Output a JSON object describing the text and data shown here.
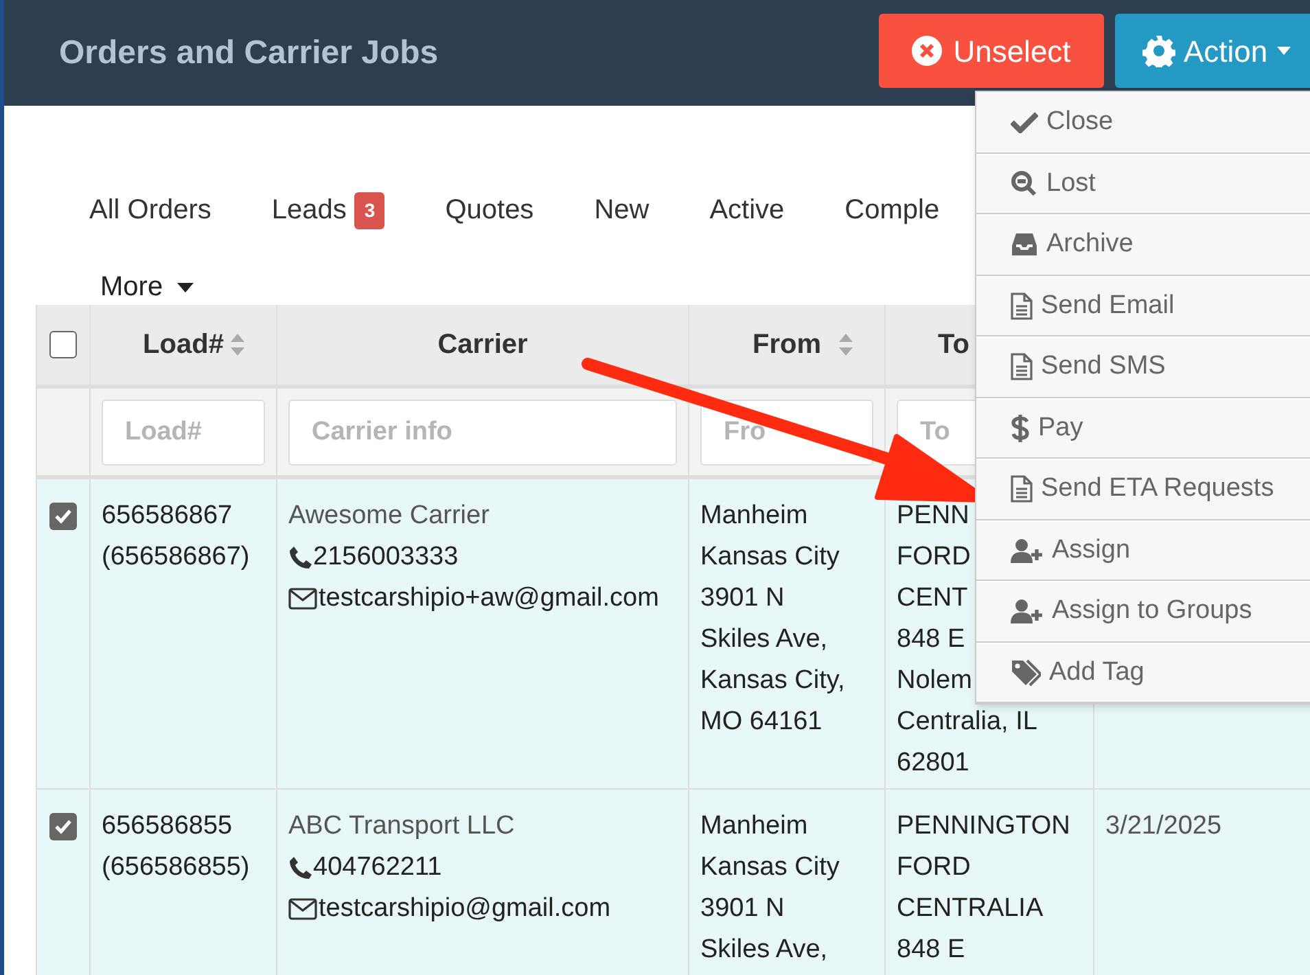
{
  "header": {
    "title": "Orders and Carrier Jobs",
    "unselect_button": "Unselect",
    "action_button": "Action"
  },
  "tabs": [
    {
      "label": "All Orders",
      "selected": false
    },
    {
      "label": "Leads",
      "selected": false,
      "badge": "3"
    },
    {
      "label": "Quotes",
      "selected": false
    },
    {
      "label": "New",
      "selected": false
    },
    {
      "label": "Active",
      "selected": false
    },
    {
      "label": "Comple",
      "selected": false
    }
  ],
  "more_tab": "More",
  "table": {
    "all_checked": false,
    "columns": [
      {
        "label": "Load#",
        "sortable": true
      },
      {
        "label": "Carrier",
        "sortable": false
      },
      {
        "label": "From",
        "sortable": true
      },
      {
        "label": "To",
        "sortable": false
      }
    ],
    "placeholders": [
      "Load#",
      "Carrier info",
      "Fro",
      "To"
    ],
    "rows": [
      {
        "checked": true,
        "load": "656586867",
        "load_ref": "(656586867)",
        "carrier": "Awesome Carrier",
        "phone": "2156003333",
        "email": "testcarshipio+aw@gmail.com",
        "from": [
          "Manheim",
          "Kansas City",
          "3901 N",
          "Skiles Ave,",
          "Kansas City,",
          "MO 64161"
        ],
        "to": [
          "PENN",
          "FORD",
          "CENT",
          "848 E",
          "Nolem",
          "Centralia, IL",
          "62801"
        ]
      },
      {
        "checked": true,
        "load": "656586855",
        "load_ref": "(656586855)",
        "carrier": "ABC Transport LLC",
        "phone": "404762211",
        "email": "testcarshipio@gmail.com",
        "from": [
          "Manheim",
          "Kansas City",
          "3901 N",
          "Skiles Ave,"
        ],
        "to": [
          "PENNINGTON",
          "FORD",
          "CENTRALIA",
          "848 E"
        ],
        "date": "3/21/2025"
      }
    ]
  },
  "action_menu": [
    "Close",
    "Lost",
    "Archive",
    "Send Email",
    "Send SMS",
    "Pay",
    "Send ETA Requests",
    "Assign",
    "Assign to Groups",
    "Add Tag"
  ]
}
